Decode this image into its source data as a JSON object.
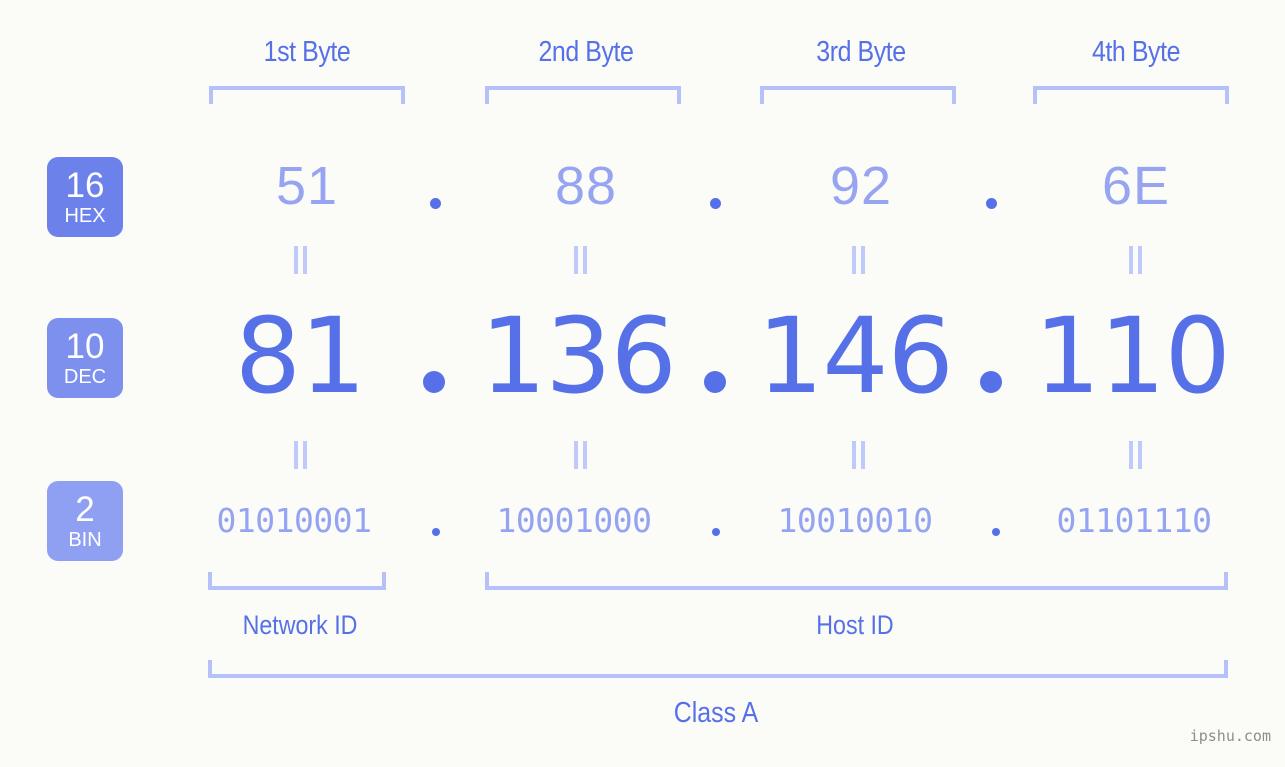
{
  "meta": {
    "background": "#fbfcf8",
    "accent": "#5670e8",
    "accent_light": "#96a4f2",
    "bracket_color": "#b6c0fb",
    "watermark": "ipshu.com"
  },
  "headers": [
    {
      "label": "1st Byte"
    },
    {
      "label": "2nd Byte"
    },
    {
      "label": "3rd Byte"
    },
    {
      "label": "4th Byte"
    }
  ],
  "rows": [
    {
      "key": "hex",
      "badge_number": "16",
      "badge_system": "HEX",
      "badge_color": "#6d81ea",
      "values": [
        "51",
        "88",
        "92",
        "6E"
      ],
      "separator": "."
    },
    {
      "key": "dec",
      "badge_number": "10",
      "badge_system": "DEC",
      "badge_color": "#7e90ee",
      "values": [
        "81",
        "136",
        "146",
        "110"
      ],
      "separator": "."
    },
    {
      "key": "bin",
      "badge_number": "2",
      "badge_system": "BIN",
      "badge_color": "#8fa0f2",
      "values": [
        "01010001",
        "10001000",
        "10010010",
        "01101110"
      ],
      "separator": "."
    }
  ],
  "equals_symbol": "||",
  "sections": [
    {
      "label": "Network ID"
    },
    {
      "label": "Host ID"
    }
  ],
  "class": {
    "label": "Class A"
  }
}
